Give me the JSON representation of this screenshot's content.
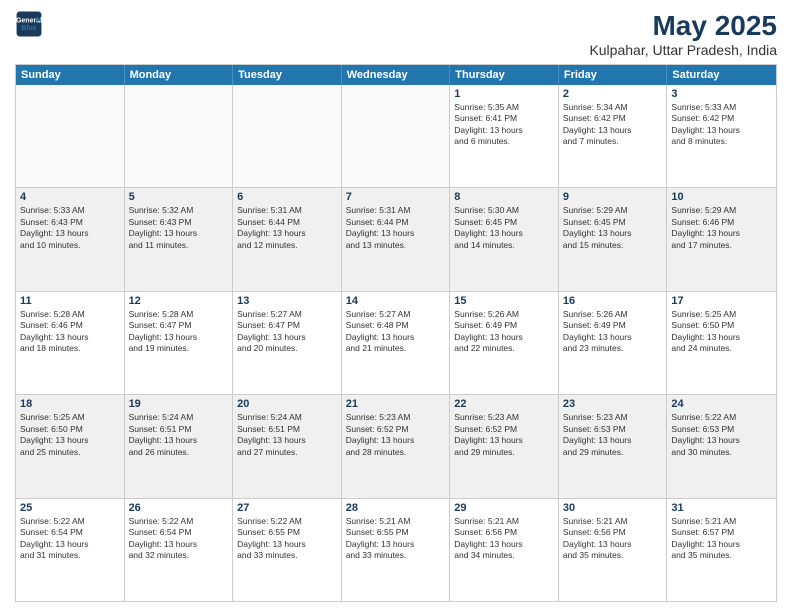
{
  "logo": {
    "line1": "General",
    "line2": "Blue"
  },
  "title": "May 2025",
  "subtitle": "Kulpahar, Uttar Pradesh, India",
  "days": [
    "Sunday",
    "Monday",
    "Tuesday",
    "Wednesday",
    "Thursday",
    "Friday",
    "Saturday"
  ],
  "weeks": [
    [
      {
        "day": "",
        "text": ""
      },
      {
        "day": "",
        "text": ""
      },
      {
        "day": "",
        "text": ""
      },
      {
        "day": "",
        "text": ""
      },
      {
        "day": "1",
        "text": "Sunrise: 5:35 AM\nSunset: 6:41 PM\nDaylight: 13 hours\nand 6 minutes."
      },
      {
        "day": "2",
        "text": "Sunrise: 5:34 AM\nSunset: 6:42 PM\nDaylight: 13 hours\nand 7 minutes."
      },
      {
        "day": "3",
        "text": "Sunrise: 5:33 AM\nSunset: 6:42 PM\nDaylight: 13 hours\nand 8 minutes."
      }
    ],
    [
      {
        "day": "4",
        "text": "Sunrise: 5:33 AM\nSunset: 6:43 PM\nDaylight: 13 hours\nand 10 minutes."
      },
      {
        "day": "5",
        "text": "Sunrise: 5:32 AM\nSunset: 6:43 PM\nDaylight: 13 hours\nand 11 minutes."
      },
      {
        "day": "6",
        "text": "Sunrise: 5:31 AM\nSunset: 6:44 PM\nDaylight: 13 hours\nand 12 minutes."
      },
      {
        "day": "7",
        "text": "Sunrise: 5:31 AM\nSunset: 6:44 PM\nDaylight: 13 hours\nand 13 minutes."
      },
      {
        "day": "8",
        "text": "Sunrise: 5:30 AM\nSunset: 6:45 PM\nDaylight: 13 hours\nand 14 minutes."
      },
      {
        "day": "9",
        "text": "Sunrise: 5:29 AM\nSunset: 6:45 PM\nDaylight: 13 hours\nand 15 minutes."
      },
      {
        "day": "10",
        "text": "Sunrise: 5:29 AM\nSunset: 6:46 PM\nDaylight: 13 hours\nand 17 minutes."
      }
    ],
    [
      {
        "day": "11",
        "text": "Sunrise: 5:28 AM\nSunset: 6:46 PM\nDaylight: 13 hours\nand 18 minutes."
      },
      {
        "day": "12",
        "text": "Sunrise: 5:28 AM\nSunset: 6:47 PM\nDaylight: 13 hours\nand 19 minutes."
      },
      {
        "day": "13",
        "text": "Sunrise: 5:27 AM\nSunset: 6:47 PM\nDaylight: 13 hours\nand 20 minutes."
      },
      {
        "day": "14",
        "text": "Sunrise: 5:27 AM\nSunset: 6:48 PM\nDaylight: 13 hours\nand 21 minutes."
      },
      {
        "day": "15",
        "text": "Sunrise: 5:26 AM\nSunset: 6:49 PM\nDaylight: 13 hours\nand 22 minutes."
      },
      {
        "day": "16",
        "text": "Sunrise: 5:26 AM\nSunset: 6:49 PM\nDaylight: 13 hours\nand 23 minutes."
      },
      {
        "day": "17",
        "text": "Sunrise: 5:25 AM\nSunset: 6:50 PM\nDaylight: 13 hours\nand 24 minutes."
      }
    ],
    [
      {
        "day": "18",
        "text": "Sunrise: 5:25 AM\nSunset: 6:50 PM\nDaylight: 13 hours\nand 25 minutes."
      },
      {
        "day": "19",
        "text": "Sunrise: 5:24 AM\nSunset: 6:51 PM\nDaylight: 13 hours\nand 26 minutes."
      },
      {
        "day": "20",
        "text": "Sunrise: 5:24 AM\nSunset: 6:51 PM\nDaylight: 13 hours\nand 27 minutes."
      },
      {
        "day": "21",
        "text": "Sunrise: 5:23 AM\nSunset: 6:52 PM\nDaylight: 13 hours\nand 28 minutes."
      },
      {
        "day": "22",
        "text": "Sunrise: 5:23 AM\nSunset: 6:52 PM\nDaylight: 13 hours\nand 29 minutes."
      },
      {
        "day": "23",
        "text": "Sunrise: 5:23 AM\nSunset: 6:53 PM\nDaylight: 13 hours\nand 29 minutes."
      },
      {
        "day": "24",
        "text": "Sunrise: 5:22 AM\nSunset: 6:53 PM\nDaylight: 13 hours\nand 30 minutes."
      }
    ],
    [
      {
        "day": "25",
        "text": "Sunrise: 5:22 AM\nSunset: 6:54 PM\nDaylight: 13 hours\nand 31 minutes."
      },
      {
        "day": "26",
        "text": "Sunrise: 5:22 AM\nSunset: 6:54 PM\nDaylight: 13 hours\nand 32 minutes."
      },
      {
        "day": "27",
        "text": "Sunrise: 5:22 AM\nSunset: 6:55 PM\nDaylight: 13 hours\nand 33 minutes."
      },
      {
        "day": "28",
        "text": "Sunrise: 5:21 AM\nSunset: 6:55 PM\nDaylight: 13 hours\nand 33 minutes."
      },
      {
        "day": "29",
        "text": "Sunrise: 5:21 AM\nSunset: 6:56 PM\nDaylight: 13 hours\nand 34 minutes."
      },
      {
        "day": "30",
        "text": "Sunrise: 5:21 AM\nSunset: 6:56 PM\nDaylight: 13 hours\nand 35 minutes."
      },
      {
        "day": "31",
        "text": "Sunrise: 5:21 AM\nSunset: 6:57 PM\nDaylight: 13 hours\nand 35 minutes."
      }
    ]
  ]
}
